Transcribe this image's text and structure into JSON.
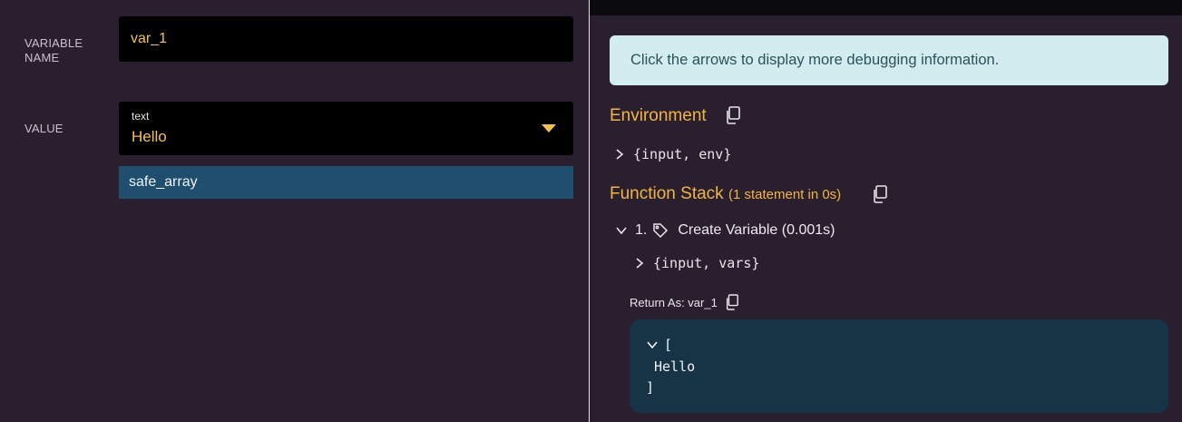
{
  "form": {
    "variable_name_label": "VARIABLE NAME",
    "variable_name_value": "var_1",
    "value_label": "VALUE",
    "value_type": "text",
    "value_text": "Hello",
    "dropdown_option": "safe_array"
  },
  "debug": {
    "info_message": "Click the arrows to display more debugging information.",
    "environment_title": "Environment",
    "environment_tree": "{input, env}",
    "function_stack_title": "Function Stack",
    "function_stack_subtitle": "(1 statement in 0s)",
    "statement_index": "1.",
    "statement_label": "Create Variable (0.001s)",
    "statement_tree": "{input, vars}",
    "return_as": "Return As: var_1",
    "result_open": "[",
    "result_item": "Hello",
    "result_close": "]"
  },
  "icons": {
    "copy": "copy-icon",
    "tag": "tag-icon",
    "chevron_right": "chevron-right-icon",
    "chevron_down": "chevron-down-icon",
    "dropdown_caret": "caret-down-icon"
  },
  "colors": {
    "background": "#2a1f2f",
    "accent": "#f2b441",
    "selected_option": "#1f4e6e",
    "info_bg": "#d3ecef",
    "result_bg": "#173447"
  }
}
